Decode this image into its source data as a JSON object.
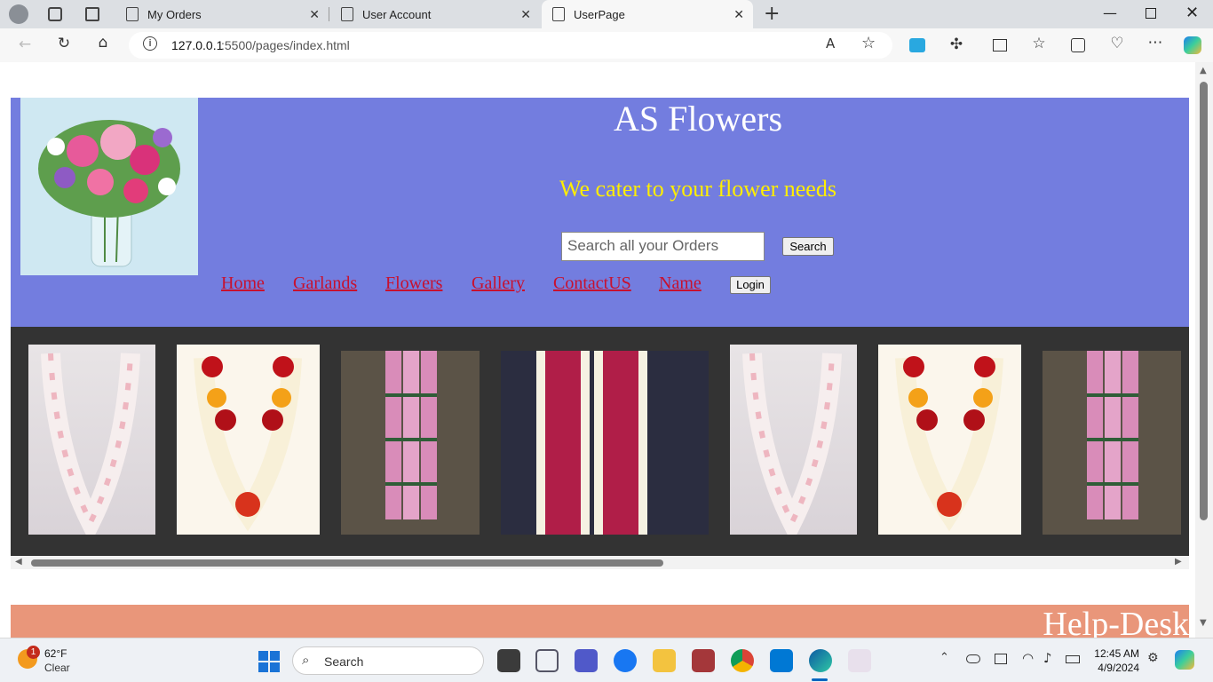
{
  "browser": {
    "tabs": [
      {
        "label": "My Orders"
      },
      {
        "label": "User Account"
      },
      {
        "label": "UserPage"
      }
    ],
    "url_host": "127.0.0.1",
    "url_rest": ":5500/pages/index.html"
  },
  "header": {
    "title": "AS Flowers",
    "tagline": "We cater to your flower needs",
    "search_placeholder": "Search all your Orders",
    "search_button": "Search",
    "nav": [
      "Home",
      "Garlands",
      "Flowers",
      "Gallery",
      "ContactUS",
      "Name"
    ],
    "login_button": "Login"
  },
  "gallery": {
    "images": [
      "white-pink-garland",
      "rose-marigold-garland",
      "pink-jasmine-garland",
      "red-rose-garland",
      "white-pink-garland",
      "rose-marigold-garland",
      "pink-jasmine-garland"
    ]
  },
  "helpdesk": {
    "title": "Help-Desk"
  },
  "taskbar": {
    "weather_temp": "62°F",
    "weather_desc": "Clear",
    "weather_badge": "1",
    "search_label": "Search",
    "time": "12:45 AM",
    "date": "4/9/2024"
  },
  "colors": {
    "header_bg": "#737ddf",
    "gallery_bg": "#333333",
    "helpdesk_bg": "#e9967a",
    "nav_link": "#c8102e",
    "tagline": "#ffee00"
  }
}
